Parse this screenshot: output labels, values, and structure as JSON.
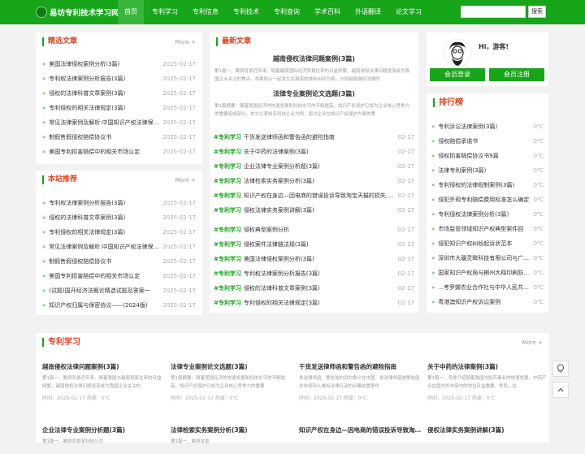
{
  "site": {
    "logo_text": "易坊专利技术学习网"
  },
  "nav": [
    {
      "label": "首页"
    },
    {
      "label": "专利学习"
    },
    {
      "label": "专利信息"
    },
    {
      "label": "专利技术"
    },
    {
      "label": "专利查询"
    },
    {
      "label": "学术百科"
    },
    {
      "label": "外语翻译"
    },
    {
      "label": "论文学习"
    }
  ],
  "search": {
    "button": "搜索",
    "placeholder": ""
  },
  "featured": {
    "title": "精选文章",
    "more": "More +",
    "items": [
      {
        "t": "美国法律侵权案例分析(3篇)",
        "d": "2025-02-17"
      },
      {
        "t": "专利权法律案例分析报告(3篇)",
        "d": "2025-02-17"
      },
      {
        "t": "侵权的法律科普文章案例(3篇)",
        "d": "2025-02-17"
      },
      {
        "t": "专利侵权的相关法律规定(3篇)",
        "d": "2025-02-17"
      },
      {
        "t": "常见法律案例及解析:中国知识产权法律保护...",
        "d": "2025-02-17"
      },
      {
        "t": "制假售假侵权赔偿协议书",
        "d": "2025-02-17"
      },
      {
        "t": "美国专利损害赔偿中的相关市场认定",
        "d": "2025-02-17"
      }
    ]
  },
  "recommend": {
    "title": "本站推荐",
    "more": "More +",
    "items": [
      {
        "t": "专利权法律案例分析报告(3篇)",
        "d": "2025-02-17"
      },
      {
        "t": "侵权的法律科普文章案例(3篇)",
        "d": "2025-02-17"
      },
      {
        "t": "专利侵权的相关法律规定(3篇)",
        "d": "2025-02-17"
      },
      {
        "t": "常见法律案例及解析:中国知识产权法律保护...",
        "d": "2025-02-17"
      },
      {
        "t": "制假售假侵权赔偿协议书",
        "d": "2025-02-17"
      },
      {
        "t": "美国专利损害赔偿中的相关市场认定",
        "d": "2025-02-17"
      },
      {
        "t": "(试题)国开经济法概论精选试题及答案一",
        "d": "2025-02-17"
      },
      {
        "t": "知识产权归属与保密协议——(2024版)",
        "d": "2025-02-17"
      }
    ]
  },
  "latest": {
    "title": "最新文章",
    "highlights": [
      {
        "title": "越南侵权法律问题案例(3篇)",
        "text": "第1篇一、案例背景近年来，随着越南国际经济贸易往来的日益频繁，越南侵权法律问题逐渐成为我国企业关注的焦点。本案例以一起发生在越南的侵权纠纷为例，分析越南侵权法律的"
      },
      {
        "title": "法律专业案例论文选题(3篇)",
        "text": "第1篇摘要：随着我国经济的快速发展和科技水平的不断提高，知识产权保护已成为企业核心竞争力的重要组成部分。本文以某知名科技企业为例，探讨企业在知识产权保护方面的策"
      }
    ],
    "items": [
      {
        "tag": "#专利学习",
        "t": "干货发送律师函和警告函的避险指南",
        "d": "02-17"
      },
      {
        "tag": "#专利学习",
        "t": "关于中药的法律案例(3篇)",
        "d": "02-17"
      },
      {
        "tag": "#专利学习",
        "t": "企业法律专业案例分析题(3篇)",
        "d": "02-17"
      },
      {
        "tag": "#专利学习",
        "t": "法律检索实务案例分析(3篇)",
        "d": "02-17"
      },
      {
        "tag": "#专利学习",
        "t": "知识产权在身边—因电商的错误投诉导致淘宝天猫的损失,该...",
        "d": "02-17"
      },
      {
        "tag": "#专利学习",
        "t": "侵权法律实务案例讲解(3篇)",
        "d": "02-17"
      },
      {
        "tag": "#专利学习",
        "t": "侵权典型案例分析",
        "d": "02-17"
      },
      {
        "tag": "#专利学习",
        "t": "侵权案件法律链法规(3篇)",
        "d": "02-17"
      },
      {
        "tag": "#专利学习",
        "t": "美国法律侵权案例分析(3篇)",
        "d": "02-17"
      },
      {
        "tag": "#专利学习",
        "t": "专利权法律案例分析报告(3篇)",
        "d": "02-17"
      },
      {
        "tag": "#专利学习",
        "t": "侵权的法律科普文章案例(3篇)",
        "d": "02-17"
      },
      {
        "tag": "#专利学习",
        "t": "专利侵权的相关法律规定(3篇)",
        "d": "02-17"
      }
    ]
  },
  "user": {
    "greeting": "Hi，游客!",
    "login": "会员登录",
    "register": "会员注册"
  },
  "ranking": {
    "title": "排行榜",
    "items": [
      {
        "t": "专利诉讼法律案例(3篇)",
        "d": "0℃"
      },
      {
        "t": "侵权赔偿承诺书",
        "d": "0℃"
      },
      {
        "t": "侵权损害赔偿协议书9篇",
        "d": "0℃"
      },
      {
        "t": "法律专利案例(3篇)",
        "d": "0℃"
      },
      {
        "t": "专利侵权的法律规制案例(3篇)",
        "d": "0℃"
      },
      {
        "t": "侵犯外观专利赔偿费用标准怎么确定",
        "d": "0℃"
      },
      {
        "t": "专利侵权法律案例分析(3篇)",
        "d": "0℃"
      },
      {
        "t": "市场监管领域知识产权典型案件回",
        "d": "0℃"
      },
      {
        "t": "侵犯知识产权纠纷起诉状范本",
        "d": "0℃"
      },
      {
        "t": "深圳市大疆灵眸科技有限公司与广...",
        "d": "0℃"
      },
      {
        "t": "国家知识产权局与郴州大翔印刷防伪...",
        "d": "0℃"
      },
      {
        "t": "...考罗娜农业合作社与中华人民共和...",
        "d": "0℃"
      },
      {
        "t": "粤港澳知识产权诉讼案例",
        "d": "0℃"
      }
    ]
  },
  "study": {
    "title": "专利学习",
    "more": "More +",
    "items": [
      {
        "title": "越南侵权法律问题案例(3篇)",
        "text": "第1篇一、案例背景近年来，随着我国与越南贸易往来的日益频繁，越南侵权法律问题逐渐成为我国企业关注的",
        "meta": "时间：2025-02-17  热度：0℃"
      },
      {
        "title": "法律专业案例论文选题(3篇)",
        "text": "第1篇摘要：随着我国经济的快速发展和科技水平的不断提高，知识产权保护已成为企业核心竞争力的重要",
        "meta": "时间：2025-02-17  热度：0℃"
      },
      {
        "title": "干货发送律师函和警告函的避险指南",
        "text": "发送律师函、警告信的目的意义在中国，发送律师函或警告函并非权利人维权法律行动的必要前置条件",
        "meta": "时间：2025-02-17  热度：0℃"
      },
      {
        "title": "关于中药的法律案例(3篇)",
        "text": "第1篇一、背景介绍随着我国中医药事业的快速发展，中药产业在国内外市场中的地位日益重要。然而，在",
        "meta": "时间：2025-02-17  热度：0℃"
      },
      {
        "title": "企业法律专业案例分析题(3篇)",
        "text": "第1篇一、案例背景某科技公司",
        "meta": ""
      },
      {
        "title": "法律检索实务案例分析(3篇)",
        "text": "第1篇一、案例背景",
        "meta": ""
      },
      {
        "title": "知识产权在身边—因电商的错误投诉导致淘...",
        "text": "",
        "meta": ""
      },
      {
        "title": "侵权法律实务案例讲解(3篇)",
        "text": "",
        "meta": ""
      }
    ]
  }
}
